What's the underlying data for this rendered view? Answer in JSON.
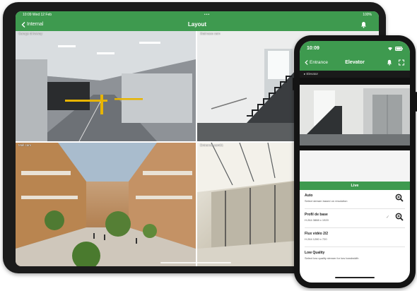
{
  "tablet": {
    "status": {
      "time": "10:09",
      "date": "Wed 12 Feb",
      "battery": "100%"
    },
    "nav": {
      "back_label": "Internal",
      "title": "Layout"
    },
    "cameras": [
      {
        "label": "Garage driveway"
      },
      {
        "label": "Staircase cam"
      },
      {
        "label": "Mall cam"
      },
      {
        "label": "Entrance cam01"
      }
    ]
  },
  "phone": {
    "time": "10:09",
    "nav": {
      "back_label": "Entrance",
      "title": "Elevator"
    },
    "breadcrumb": "Elevator",
    "live_label": "Live",
    "streams": [
      {
        "title": "Auto",
        "subtitle": "Select stream based on resolution",
        "selected": false,
        "zoom": true
      },
      {
        "title": "Profil de base",
        "subtitle": "H.264 3888 x 1920",
        "selected": true,
        "zoom": true
      },
      {
        "title": "Flux vidéo 2/2",
        "subtitle": "H.264 1280 x 720",
        "selected": false,
        "zoom": false
      },
      {
        "title": "Low Quality",
        "subtitle": "Select low quality stream for low bandwidth",
        "selected": false,
        "zoom": false
      }
    ]
  },
  "colors": {
    "accent": "#3e9a4f",
    "device": "#1b1b1b"
  },
  "icons": [
    "chevron-left-icon",
    "bell-icon",
    "wifi-icon",
    "battery-icon",
    "zoom-in-icon",
    "checkmark-icon",
    "fullscreen-icon"
  ]
}
